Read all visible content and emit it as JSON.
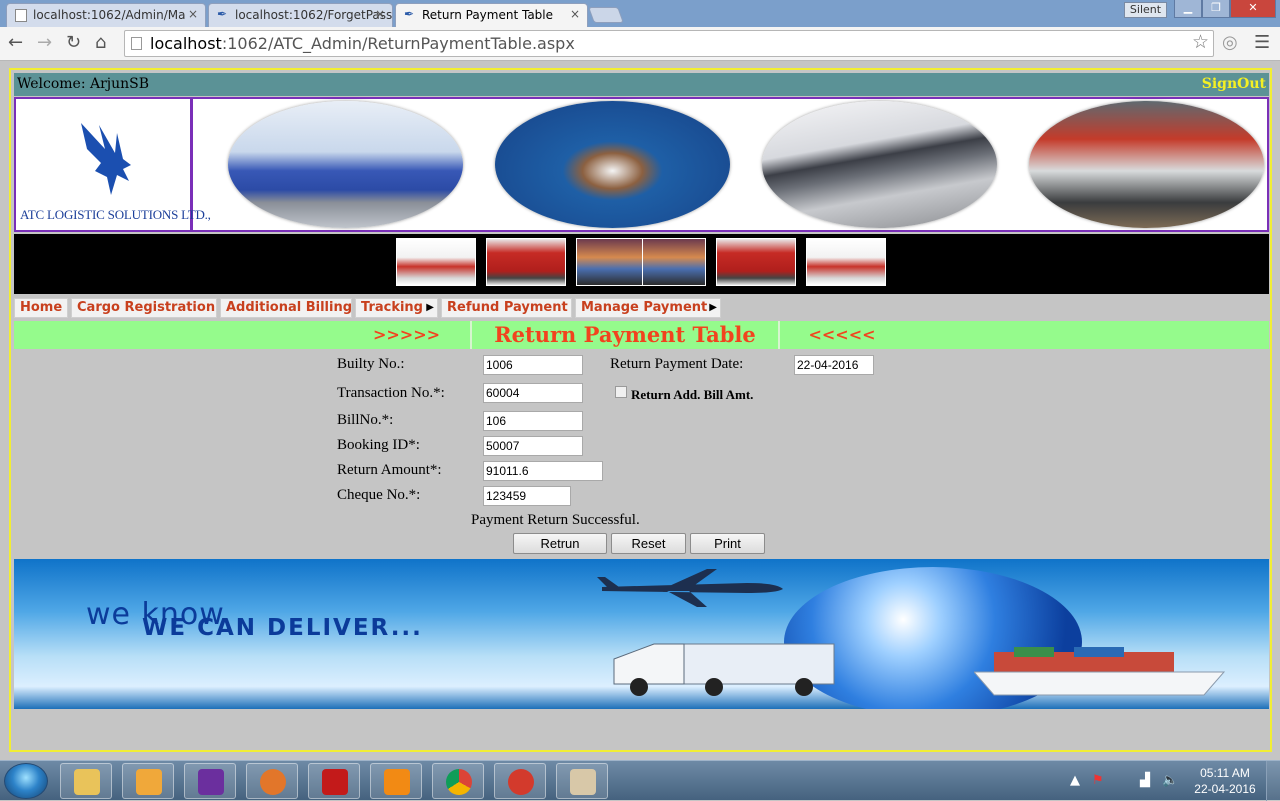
{
  "browser": {
    "tabs": [
      {
        "title": "localhost:1062/Admin/Ma",
        "active": false
      },
      {
        "title": "localhost:1062/ForgetPass",
        "active": false
      },
      {
        "title": "Return Payment Table",
        "active": true
      }
    ],
    "close_glyph": "×",
    "silent_label": "Silent",
    "window_controls": {
      "minimize": "▁",
      "maximize": "❐",
      "close": "✕"
    },
    "url_host": "localhost",
    "url_rest": ":1062/ATC_Admin/ReturnPaymentTable.aspx",
    "nav_icons": {
      "back": "back-arrow-icon",
      "forward": "forward-arrow-icon",
      "reload": "reload-icon",
      "home": "home-icon",
      "star": "bookmark-star-icon",
      "menu": "hamburger-menu-icon"
    },
    "nav_glyphs": {
      "back": "←",
      "forward": "→",
      "reload": "↻",
      "home": "⌂",
      "star": "☆",
      "ext": "◎",
      "menu": "☰"
    }
  },
  "header": {
    "welcome": "Welcome: ArjunSB",
    "signout": "SignOut",
    "logo_text": "ATC LOGISTIC SOLUTIONS LTD.,"
  },
  "menu": {
    "items": [
      {
        "label": "Home",
        "has_submenu": false
      },
      {
        "label": "Cargo Registration",
        "has_submenu": false
      },
      {
        "label": "Additional Billing",
        "has_submenu": false
      },
      {
        "label": "Tracking",
        "has_submenu": true
      },
      {
        "label": "Refund Payment",
        "has_submenu": false
      },
      {
        "label": "Manage Payment",
        "has_submenu": true
      }
    ],
    "submenu_glyph": "▶"
  },
  "title_bar": {
    "left": ">>>>>",
    "title": "Return Payment Table",
    "right": "<<<<<"
  },
  "form": {
    "builty_label": "Builty No.:",
    "builty_value": "1006",
    "return_date_label": "Return Payment Date:",
    "return_date_value": "22-04-2016",
    "transaction_label": "Transaction No.*:",
    "transaction_value": "60004",
    "return_add_bill_label": "Return Add. Bill Amt.",
    "return_add_bill_checked": false,
    "billno_label": "BillNo.*:",
    "billno_value": "106",
    "booking_label": "Booking ID*:",
    "booking_value": "50007",
    "return_amount_label": "Return Amount*:",
    "return_amount_value": "91011.6",
    "cheque_label": "Cheque No.*:",
    "cheque_value": "123459",
    "status_message": "Payment Return Successful.",
    "buttons": {
      "retrun": "Retrun",
      "reset": "Reset",
      "print": "Print"
    }
  },
  "footer_banner": {
    "line1": "we know",
    "line2": "WE CAN DELIVER..."
  },
  "taskbar": {
    "time": "05:11 AM",
    "date": "22-04-2016",
    "tray_glyphs": {
      "up": "▲",
      "flag": "⚑",
      "network": "▟",
      "volume": "🔈"
    },
    "apps": [
      "windows-explorer-icon",
      "media-player-icon",
      "visual-studio-icon",
      "firefox-icon",
      "acrobat-reader-icon",
      "vlc-icon",
      "chrome-icon",
      "ccleaner-icon",
      "paint-icon"
    ]
  },
  "colors": {
    "welcome_bar": "#5b9296",
    "signout": "#f5f023",
    "menu_text": "#c8401e",
    "title_bar_bg": "#95fb8c",
    "title_text": "#f2431e",
    "banner_border": "#7a2fb8",
    "frame_border": "#f2ee32"
  }
}
